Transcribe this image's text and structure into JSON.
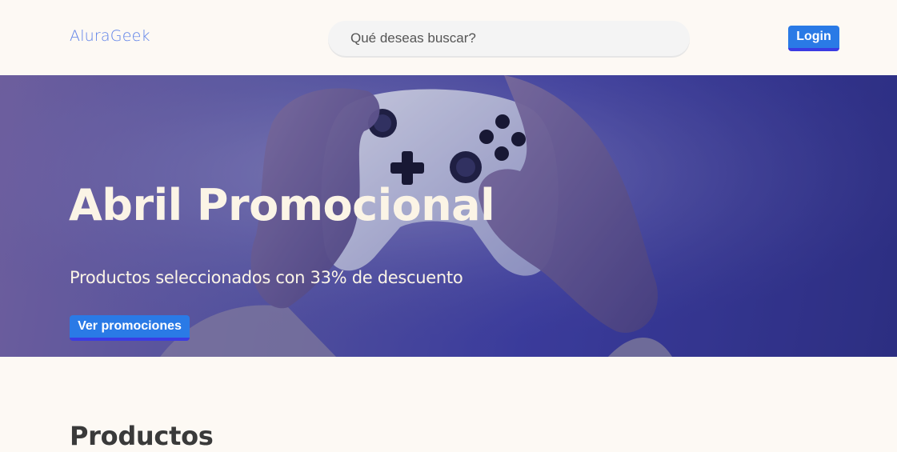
{
  "header": {
    "logo": "AluraGeek",
    "search_placeholder": "Qué deseas buscar?",
    "login_label": "Login"
  },
  "hero": {
    "title": "Abril Promocional",
    "subtitle": "Productos seleccionados con 33% de descuento",
    "button_label": "Ver promociones"
  },
  "products": {
    "title": "Productos"
  },
  "colors": {
    "background": "#fdf9f4",
    "accent": "#2a7ae6",
    "accent_border": "#3b3be3",
    "logo": "#5b7fe8"
  }
}
